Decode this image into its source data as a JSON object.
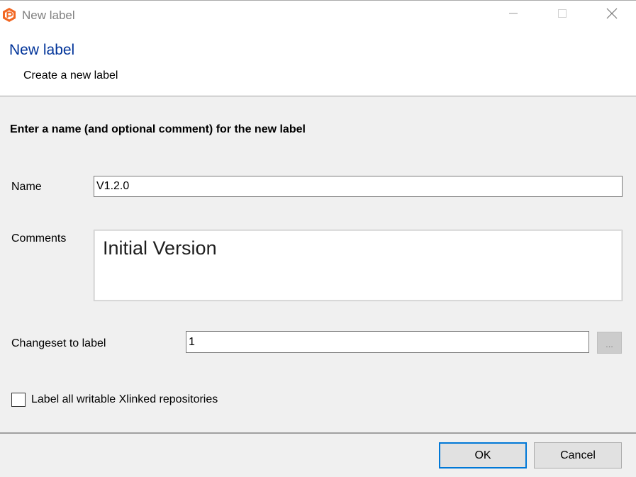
{
  "window": {
    "title": "New label"
  },
  "header": {
    "title": "New label",
    "subtitle": "Create a new label"
  },
  "form": {
    "instruction": "Enter a name (and optional comment) for the new label",
    "name_label": "Name",
    "name_value": "V1.2.0",
    "comments_label": "Comments",
    "comments_value": "Initial Version",
    "changeset_label": "Changeset to label",
    "changeset_value": "1",
    "browse_label": "...",
    "xlinked_label": "Label all writable Xlinked repositories",
    "xlinked_checked": false
  },
  "footer": {
    "ok_label": "OK",
    "cancel_label": "Cancel"
  },
  "colors": {
    "accent": "#0078d7",
    "header_title": "#003399",
    "brand_icon": "#f26722"
  },
  "icons": {
    "app": "plastic-scm-logo-icon",
    "minimize": "minimize-icon",
    "maximize": "maximize-icon",
    "close": "close-icon"
  }
}
